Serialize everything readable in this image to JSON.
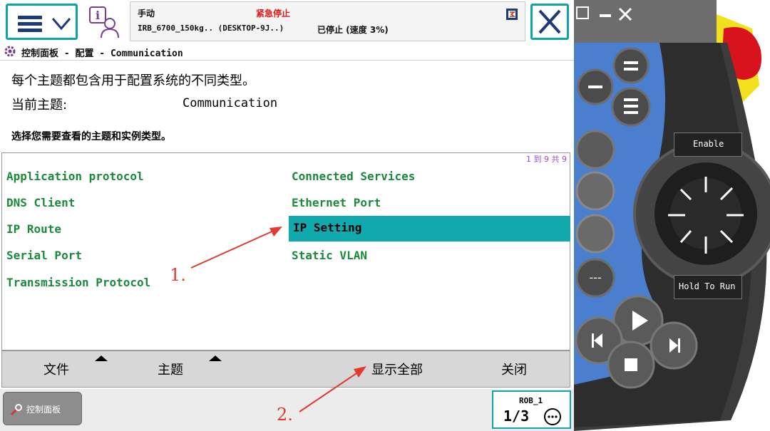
{
  "status": {
    "mode": "手动",
    "estop": "紧急停止",
    "robot": "IRB_6700_150kg.. (DESKTOP-9J..)",
    "state": "已停止 (速度 3%)"
  },
  "breadcrumb": "控制面板 - 配置 - Communication",
  "description": {
    "line1": "每个主题都包含用于配置系统的不同类型。",
    "current_topic_label": "当前主题:",
    "current_topic_value": "Communication",
    "prompt": "选择您需要查看的主题和实例类型。"
  },
  "list": {
    "pager": "1 到 9 共 9",
    "items": [
      {
        "label": "Application protocol"
      },
      {
        "label": "Connected Services"
      },
      {
        "label": "DNS Client"
      },
      {
        "label": "Ethernet Port"
      },
      {
        "label": "IP Route"
      },
      {
        "label": "IP Setting",
        "selected": true
      },
      {
        "label": "Serial Port"
      },
      {
        "label": "Static VLAN"
      },
      {
        "label": "Transmission Protocol"
      }
    ]
  },
  "bottom_menu": {
    "file": "文件",
    "topic": "主题",
    "show_all": "显示全部",
    "close": "关闭"
  },
  "taskbar": {
    "control_panel": "控制面板",
    "rob": "ROB_1",
    "fraction": "1/3"
  },
  "annotations": {
    "step1": "1.",
    "step2": "2."
  },
  "pendant": {
    "enable": "Enable",
    "hold_to_run": "Hold To Run"
  },
  "colors": {
    "accent": "#10a9ad",
    "item_text": "#1a8a3a",
    "estop": "#e01818",
    "annotation": "#e23a2e",
    "pendant_blue": "#4a7fd0"
  }
}
